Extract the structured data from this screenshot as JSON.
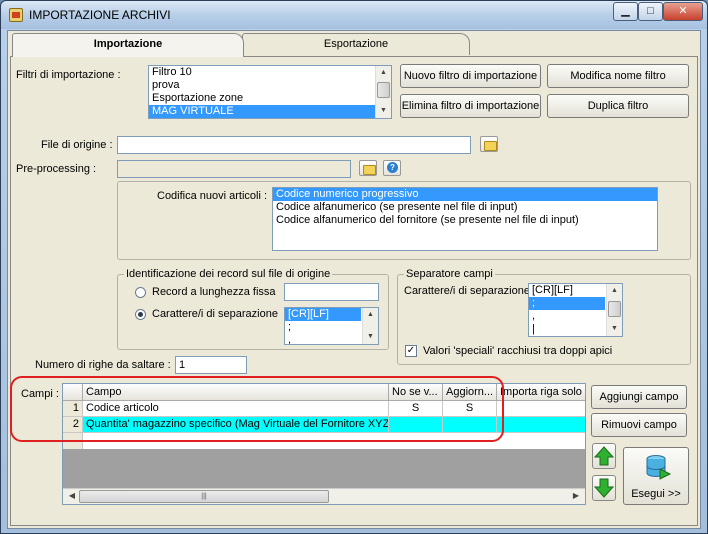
{
  "window": {
    "title": "IMPORTAZIONE ARCHIVI"
  },
  "tabs": [
    {
      "label": "Importazione",
      "active": true
    },
    {
      "label": "Esportazione",
      "active": false
    }
  ],
  "filters": {
    "label": "Filtri di importazione :",
    "items": [
      "Filtro 10",
      "prova",
      "Esportazione zone",
      "MAG VIRTUALE"
    ],
    "selected": "MAG VIRTUALE"
  },
  "buttons": {
    "new_filter": "Nuovo filtro di importazione",
    "rename_filter": "Modifica nome filtro",
    "delete_filter": "Elimina filtro di importazione",
    "duplicate_filter": "Duplica filtro",
    "add_field": "Aggiungi campo",
    "remove_field": "Rimuovi campo",
    "run": "Esegui >>"
  },
  "source_file": {
    "label": "File di origine :",
    "value": ""
  },
  "preprocessing": {
    "label": "Pre-processing :",
    "value": ""
  },
  "encoding": {
    "label": "Codifica nuovi articoli :",
    "items": [
      "Codice numerico progressivo",
      "Codice alfanumerico (se presente nel file di input)",
      "Codice alfanumerico del fornitore (se presente nel file di input)"
    ],
    "selected": "Codice numerico progressivo"
  },
  "record_identification": {
    "title": "Identificazione dei record sul file di origine",
    "fixed_length_label": "Record a lunghezza fissa",
    "separator_label": "Carattere/i di separazione",
    "fixed_length_value": "",
    "separator_items": [
      "[CR][LF]",
      ";",
      ","
    ],
    "separator_selected": "[CR][LF]"
  },
  "field_separator": {
    "title": "Separatore campi",
    "label": "Carattere/i di separazione",
    "items": [
      "[CR][LF]",
      ";",
      ",",
      "|"
    ],
    "selected": ";",
    "quoted_label": "Valori 'speciali' racchiusi tra doppi apici",
    "quoted_checked": true,
    "check_mark": "✓"
  },
  "skip_rows": {
    "label": "Numero di righe da saltare :",
    "value": "1"
  },
  "fields": {
    "label": "Campi :",
    "columns": [
      "Campo",
      "No se v...",
      "Aggiorn...",
      "Importa riga solo s"
    ],
    "rows": [
      {
        "n": "1",
        "campo": "Codice articolo",
        "nosev": "S",
        "aggiorn": "S",
        "importa": ""
      },
      {
        "n": "2",
        "campo": "Quantita' magazzino specifico (Mag Virtuale del Fornitore XYZ)",
        "nosev": "",
        "aggiorn": "",
        "importa": ""
      }
    ]
  },
  "colors": {
    "selection": "#3399ff",
    "row_highlight": "#00ffff",
    "annotation": "#e02020"
  }
}
